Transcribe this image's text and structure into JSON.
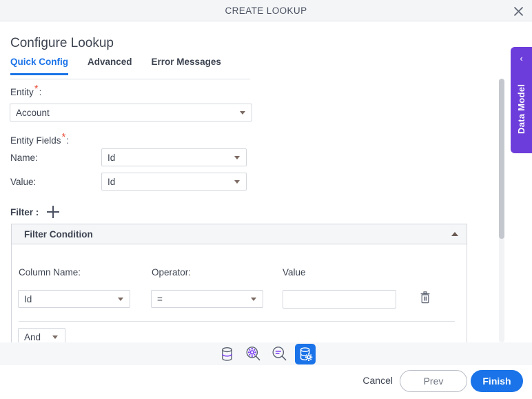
{
  "window": {
    "title": "CREATE LOOKUP",
    "close_icon": "close-icon"
  },
  "heading": "Configure Lookup",
  "tabs": [
    {
      "label": "Quick Config",
      "active": true
    },
    {
      "label": "Advanced",
      "active": false
    },
    {
      "label": "Error Messages",
      "active": false
    }
  ],
  "form": {
    "entity": {
      "label": "Entity",
      "required_marker": "*",
      "colon": ":",
      "value": "Account"
    },
    "entity_fields": {
      "label": "Entity Fields",
      "required_marker": "*",
      "colon": ":",
      "name": {
        "label": "Name:",
        "value": "Id"
      },
      "value": {
        "label": "Value:",
        "value": "Id"
      }
    },
    "filter": {
      "label": "Filter :",
      "add_icon": "plus-icon"
    }
  },
  "filter_condition": {
    "title": "Filter Condition",
    "collapse_icon": "chevron-up-icon",
    "headers": {
      "column_name": "Column Name:",
      "operator": "Operator:",
      "value": "Value"
    },
    "row": {
      "column_name": "Id",
      "operator": "=",
      "value": "",
      "value_placeholder": "",
      "delete_icon": "trash-icon"
    },
    "logical_operator": "And"
  },
  "data_model_panel": {
    "label": "Data Model",
    "chevron": "‹"
  },
  "toolbar": {
    "buttons": [
      {
        "name": "database-icon",
        "label": "Database",
        "active": false
      },
      {
        "name": "search-settings-icon",
        "label": "Search Settings",
        "active": false
      },
      {
        "name": "search-minus-icon",
        "label": "Search Minus",
        "active": false
      },
      {
        "name": "database-settings-icon",
        "label": "Database Settings",
        "active": true
      }
    ]
  },
  "footer": {
    "cancel": "Cancel",
    "prev": "Prev",
    "finish": "Finish"
  },
  "colors": {
    "accent_blue": "#1a73e8",
    "purple": "#6d3ddb",
    "required_red": "#e8513a",
    "text": "#3d4451",
    "border": "#d3d7dd",
    "header_bg": "#f4f5f7"
  }
}
